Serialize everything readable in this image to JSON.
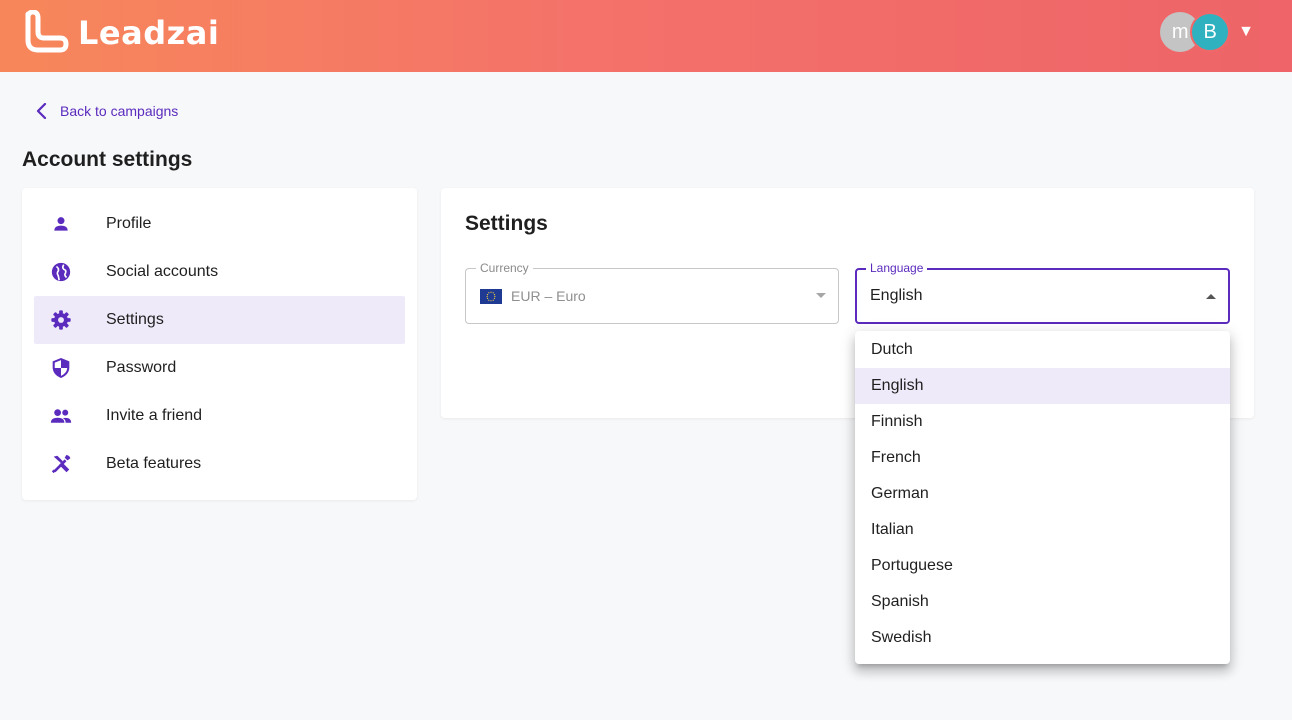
{
  "header": {
    "brand": "Leadzai",
    "avatars": [
      "m",
      "B"
    ],
    "menu_caret": "▼"
  },
  "nav": {
    "back_label": "Back to campaigns"
  },
  "page": {
    "title": "Account settings"
  },
  "sidebar": {
    "items": [
      {
        "label": "Profile",
        "icon": "person-icon"
      },
      {
        "label": "Social accounts",
        "icon": "globe-icon"
      },
      {
        "label": "Settings",
        "icon": "gear-icon",
        "active": true
      },
      {
        "label": "Password",
        "icon": "shield-icon"
      },
      {
        "label": "Invite a friend",
        "icon": "people-icon"
      },
      {
        "label": "Beta features",
        "icon": "tools-icon"
      }
    ]
  },
  "settings": {
    "title": "Settings",
    "currency": {
      "label": "Currency",
      "value": "EUR  –  Euro",
      "flag": "eu-flag-icon",
      "disabled": true
    },
    "language": {
      "label": "Language",
      "value": "English",
      "open": true
    }
  },
  "language_options": [
    "Dutch",
    "English",
    "Finnish",
    "French",
    "German",
    "Italian",
    "Portuguese",
    "Spanish",
    "Swedish"
  ],
  "language_selected": "English",
  "colors": {
    "accent": "#5b2bbd",
    "selected_bg": "#efeaf9",
    "header_start": "#f7875a",
    "header_end": "#ee6468"
  }
}
